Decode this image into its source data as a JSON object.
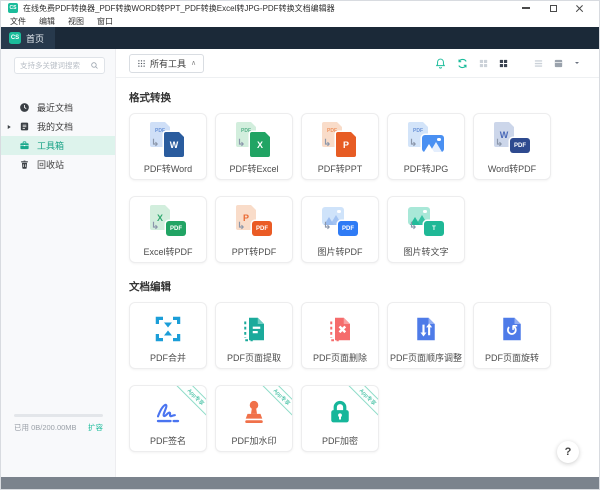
{
  "window": {
    "title": "在线免费PDF转换器_PDF转换WORD转PPT_PDF转换Excel转JPG-PDF转换文档编辑器"
  },
  "menubar": {
    "items": [
      {
        "name": "file",
        "label": "文件"
      },
      {
        "name": "edit",
        "label": "编辑"
      },
      {
        "name": "view",
        "label": "视图"
      },
      {
        "name": "window",
        "label": "窗口"
      }
    ]
  },
  "tabbar": {
    "logo_text": "CS",
    "active_tab": "首页"
  },
  "toolbar": {
    "all_tools_label": "所有工具",
    "collapse_caret": "∧"
  },
  "sidebar": {
    "search_placeholder": "支持多关键词搜索",
    "items": [
      {
        "name": "recent-docs",
        "icon": "clock-icon",
        "label": "最近文档"
      },
      {
        "name": "my-docs",
        "icon": "document-icon",
        "label": "我的文档",
        "expandable": true
      },
      {
        "name": "toolbox",
        "icon": "toolbox-icon",
        "label": "工具箱",
        "selected": true
      },
      {
        "name": "recycle-bin",
        "icon": "trash-icon",
        "label": "回收站"
      }
    ],
    "storage": {
      "used_label": "已用 0B/200.00MB",
      "expand_label": "扩容",
      "progress_percent": 0
    }
  },
  "main": {
    "sections": [
      {
        "title": "格式转换",
        "cards": [
          {
            "name": "pdf-to-word",
            "label": "PDF转Word",
            "icon_spec": {
              "back": {
                "kind": "page",
                "fill": "#cfdff7",
                "text": "PDF",
                "text_color": "#6a93d8",
                "small": true
              },
              "front": {
                "kind": "page",
                "fill": "#2a5c9e",
                "text": "W",
                "text_color": "#ffffff"
              },
              "arrow_color": "#8b97ab"
            }
          },
          {
            "name": "pdf-to-excel",
            "label": "PDF转Excel",
            "icon_spec": {
              "back": {
                "kind": "page",
                "fill": "#d2eedd",
                "text": "PDF",
                "text_color": "#57b189",
                "small": true
              },
              "front": {
                "kind": "page",
                "fill": "#21a464",
                "text": "X",
                "text_color": "#ffffff"
              },
              "arrow_color": "#8b97ab"
            }
          },
          {
            "name": "pdf-to-ppt",
            "label": "PDF转PPT",
            "icon_spec": {
              "back": {
                "kind": "page",
                "fill": "#f9dcc9",
                "text": "PDF",
                "text_color": "#ee9460",
                "small": true
              },
              "front": {
                "kind": "page",
                "fill": "#e75c24",
                "text": "P",
                "text_color": "#ffffff"
              },
              "arrow_color": "#8b97ab"
            }
          },
          {
            "name": "pdf-to-jpg",
            "label": "PDF转JPG",
            "icon_spec": {
              "back": {
                "kind": "page",
                "fill": "#d3e4f9",
                "text": "PDF",
                "text_color": "#6a93d8",
                "small": true
              },
              "front": {
                "kind": "thumb",
                "fill": "#4a90f2",
                "art": "#ffffff"
              },
              "arrow_color": "#8b97ab"
            }
          },
          {
            "name": "word-to-pdf",
            "label": "Word转PDF",
            "icon_spec": {
              "back": {
                "kind": "page",
                "fill": "#ccd6ea",
                "text": "W",
                "text_color": "#4a69b8"
              },
              "front": {
                "kind": "badge",
                "fill": "#2e4a8f",
                "text": "PDF",
                "text_color": "#ffffff"
              },
              "arrow_color": "#8b97ab"
            }
          },
          {
            "name": "excel-to-pdf",
            "label": "Excel转PDF",
            "icon_spec": {
              "back": {
                "kind": "page",
                "fill": "#d2eedd",
                "text": "X",
                "text_color": "#2fa86f"
              },
              "front": {
                "kind": "badge",
                "fill": "#21a464",
                "text": "PDF",
                "text_color": "#ffffff"
              },
              "arrow_color": "#8b97ab"
            }
          },
          {
            "name": "ppt-to-pdf",
            "label": "PPT转PDF",
            "icon_spec": {
              "back": {
                "kind": "page",
                "fill": "#f9dcc9",
                "text": "P",
                "text_color": "#ea6a33"
              },
              "front": {
                "kind": "badge",
                "fill": "#ea5b25",
                "text": "PDF",
                "text_color": "#ffffff"
              },
              "arrow_color": "#8b97ab"
            }
          },
          {
            "name": "image-to-pdf",
            "label": "图片转PDF",
            "icon_spec": {
              "back": {
                "kind": "thumb",
                "fill": "#cfe3fa",
                "art": "#9bbdf0"
              },
              "front": {
                "kind": "badge",
                "fill": "#2f7bf5",
                "text": "PDF",
                "text_color": "#ffffff"
              },
              "arrow_color": "#8b97ab"
            }
          },
          {
            "name": "image-to-text",
            "label": "图片转文字",
            "icon_spec": {
              "back": {
                "kind": "thumb",
                "fill": "#a9e8d8",
                "art": "#22bb9a"
              },
              "front": {
                "kind": "badge",
                "fill": "#1fb896",
                "text": "T",
                "text_color": "#ffffff"
              },
              "arrow_color": "#8b97ab"
            }
          }
        ]
      },
      {
        "title": "文档编辑",
        "cards": [
          {
            "name": "pdf-merge",
            "label": "PDF合并",
            "icon": "pdf-merge-icon"
          },
          {
            "name": "pdf-extract-pages",
            "label": "PDF页面提取",
            "icon": "pdf-extract-icon"
          },
          {
            "name": "pdf-delete-pages",
            "label": "PDF页面删除",
            "icon": "pdf-delete-icon"
          },
          {
            "name": "pdf-reorder-pages",
            "label": "PDF页面顺序调整",
            "icon": "pdf-reorder-icon"
          },
          {
            "name": "pdf-rotate-pages",
            "label": "PDF页面旋转",
            "icon": "pdf-rotate-icon"
          },
          {
            "name": "pdf-sign",
            "label": "PDF签名",
            "icon": "pdf-sign-icon",
            "badge": "App专享"
          },
          {
            "name": "pdf-watermark",
            "label": "PDF加水印",
            "icon": "pdf-watermark-icon",
            "badge": "App专享"
          },
          {
            "name": "pdf-encrypt",
            "label": "PDF加密",
            "icon": "pdf-lock-icon",
            "badge": "App专享"
          }
        ]
      }
    ]
  },
  "help": {
    "glyph": "?"
  },
  "palette": {
    "accent_teal": "#1bbc9b",
    "tabbar_bg": "#1b2938",
    "selected_nav_bg": "#ddf3ec",
    "bottom_strip": "#7b838d"
  }
}
